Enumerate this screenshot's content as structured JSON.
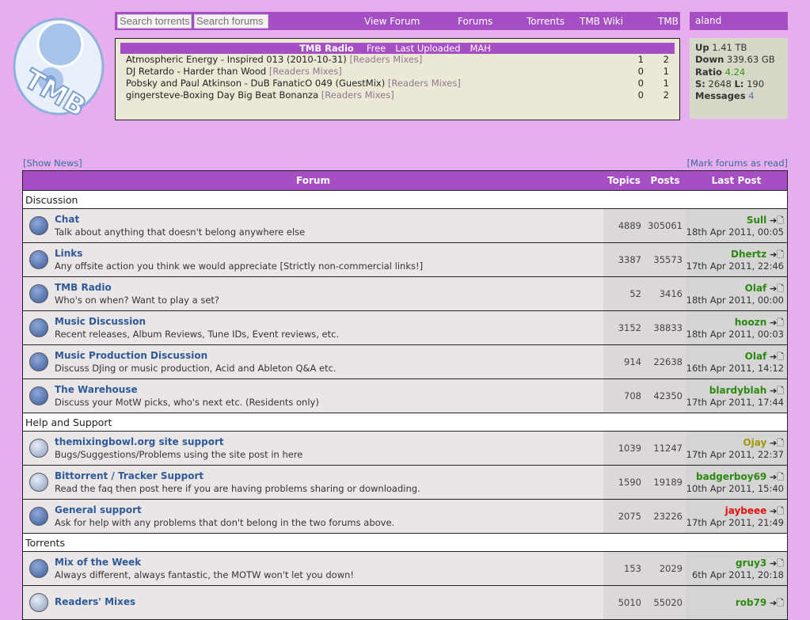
{
  "logo": "TMB",
  "search": {
    "torrents_placeholder": "Search torrents",
    "forums_placeholder": "Search forums"
  },
  "nav": [
    "View Forum",
    "Forums",
    "Torrents",
    "TMB Wiki",
    "TMB"
  ],
  "user": {
    "name": "aland"
  },
  "radio": {
    "header": [
      "TMB Radio",
      "Free",
      "Last Uploaded",
      "MAH"
    ],
    "items": [
      {
        "title": "Atmospheric Energy - Inspired 013 (2010-10-31)",
        "cat": "[Readers Mixes]",
        "s": "1",
        "l": "2"
      },
      {
        "title": "DJ Retardo - Harder than Wood",
        "cat": "[Readers Mixes]",
        "s": "0",
        "l": "1"
      },
      {
        "title": "Pobsky and Paul Atkinson - DuB FanaticO 049 (GuestMix)",
        "cat": "[Readers Mixes]",
        "s": "0",
        "l": "1"
      },
      {
        "title": "gingersteve-Boxing Day Big Beat Bonanza",
        "cat": "[Readers Mixes]",
        "s": "0",
        "l": "2"
      }
    ]
  },
  "stats": {
    "up_label": "Up",
    "up": "1.41 TB",
    "down_label": "Down",
    "down": "339.63 GB",
    "ratio_label": "Ratio",
    "ratio": "4.24",
    "s_label": "S:",
    "s": "2648",
    "l_label": "L:",
    "l": "190",
    "messages_label": "Messages",
    "messages": "4"
  },
  "show_news": "[Show News]",
  "mark_read": "[Mark forums as read]",
  "table": {
    "headers": [
      "Forum",
      "Topics",
      "Posts",
      "Last Post"
    ],
    "sections": [
      {
        "name": "Discussion",
        "forums": [
          {
            "name": "Chat",
            "desc": "Talk about anything that doesn't belong anywhere else",
            "topics": "4889",
            "posts": "305061",
            "user": "Sull",
            "color": "#2a8a10",
            "date": "18th Apr 2011, 00:05",
            "new": true
          },
          {
            "name": "Links",
            "desc": "Any offsite action you think we would appreciate [Strictly non-commercial links!]",
            "topics": "3387",
            "posts": "35573",
            "user": "Dhertz",
            "color": "#2a8a10",
            "date": "17th Apr 2011, 22:46",
            "new": true
          },
          {
            "name": "TMB Radio",
            "desc": "Who's on when? Want to play a set?",
            "topics": "52",
            "posts": "3416",
            "user": "Olaf",
            "color": "#2a8a10",
            "date": "18th Apr 2011, 00:00",
            "new": true
          },
          {
            "name": "Music Discussion",
            "desc": "Recent releases, Album Reviews, Tune IDs, Event reviews, etc.",
            "topics": "3152",
            "posts": "38833",
            "user": "hoozn",
            "color": "#2a8a10",
            "date": "18th Apr 2011, 00:03",
            "new": true
          },
          {
            "name": "Music Production Discussion",
            "desc": "Discuss DJing or music production, Acid and Ableton Q&A etc.",
            "topics": "914",
            "posts": "22638",
            "user": "Olaf",
            "color": "#2a8a10",
            "date": "16th Apr 2011, 14:12",
            "new": true
          },
          {
            "name": "The Warehouse",
            "desc": "Discuss your MotW picks, who's next etc. (Residents only)",
            "topics": "708",
            "posts": "42350",
            "user": "blardyblah",
            "color": "#2a8a10",
            "date": "17th Apr 2011, 17:44",
            "new": true
          }
        ]
      },
      {
        "name": "Help and Support",
        "forums": [
          {
            "name": "themixingbowl.org site support",
            "desc": "Bugs/Suggestions/Problems using the site post in here",
            "topics": "1039",
            "posts": "11247",
            "user": "Ojay",
            "color": "#9a9a00",
            "date": "17th Apr 2011, 22:37",
            "new": false
          },
          {
            "name": "Bittorrent / Tracker Support",
            "desc": "Read the faq then post here if you are having problems sharing or downloading.",
            "topics": "1590",
            "posts": "19189",
            "user": "badgerboy69",
            "color": "#2a8a10",
            "date": "10th Apr 2011, 15:40",
            "new": false
          },
          {
            "name": "General support",
            "desc": "Ask for help with any problems that don't belong in the two forums above.",
            "topics": "2075",
            "posts": "23226",
            "user": "jaybeee",
            "color": "#e01010",
            "date": "17th Apr 2011, 21:49",
            "new": true
          }
        ]
      },
      {
        "name": "Torrents",
        "forums": [
          {
            "name": "Mix of the Week",
            "desc": "Always different, always fantastic, the MOTW won't let you down!",
            "topics": "153",
            "posts": "2029",
            "user": "gruy3",
            "color": "#2a8a10",
            "date": "6th Apr 2011, 20:18",
            "new": true
          },
          {
            "name": "Readers' Mixes",
            "desc": "",
            "topics": "5010",
            "posts": "55020",
            "user": "rob79",
            "color": "#2a8a10",
            "date": "",
            "new": false
          }
        ]
      }
    ]
  },
  "goto_icon": "➔🗋"
}
